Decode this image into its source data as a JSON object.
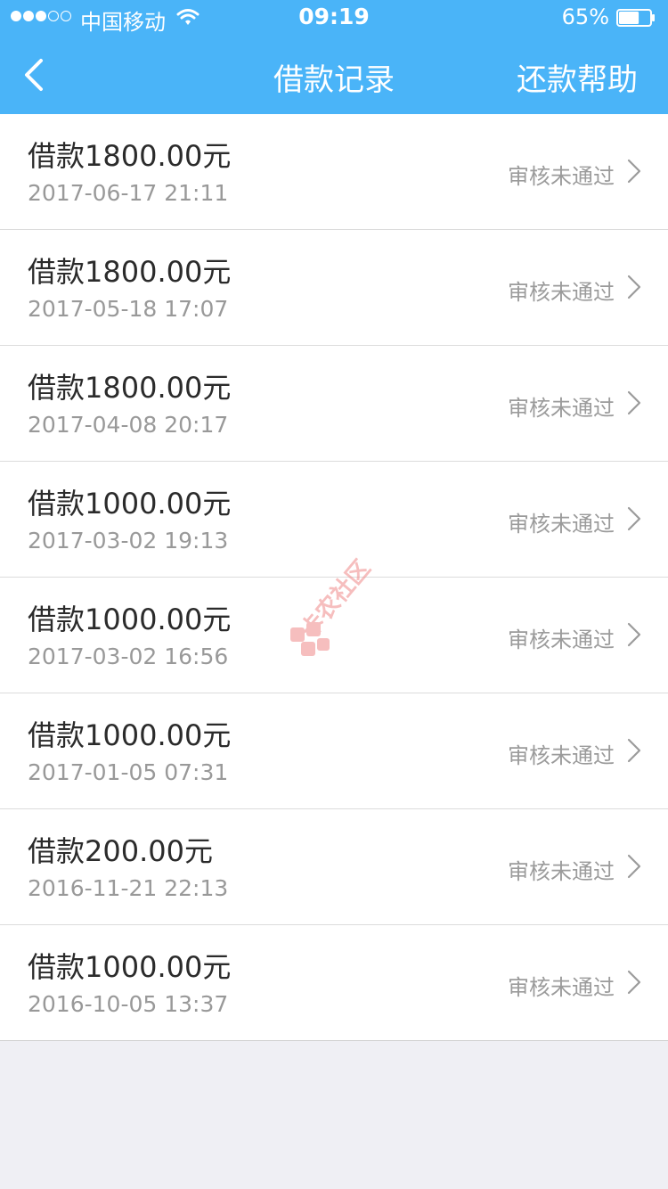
{
  "status_bar": {
    "carrier": "中国移动",
    "time": "09:19",
    "battery": "65%",
    "battery_level": 0.65
  },
  "nav": {
    "title": "借款记录",
    "right_action": "还款帮助"
  },
  "records": [
    {
      "amount": "借款1800.00元",
      "date": "2017-06-17 21:11",
      "status": "审核未通过"
    },
    {
      "amount": "借款1800.00元",
      "date": "2017-05-18 17:07",
      "status": "审核未通过"
    },
    {
      "amount": "借款1800.00元",
      "date": "2017-04-08 20:17",
      "status": "审核未通过"
    },
    {
      "amount": "借款1000.00元",
      "date": "2017-03-02 19:13",
      "status": "审核未通过"
    },
    {
      "amount": "借款1000.00元",
      "date": "2017-03-02 16:56",
      "status": "审核未通过"
    },
    {
      "amount": "借款1000.00元",
      "date": "2017-01-05 07:31",
      "status": "审核未通过"
    },
    {
      "amount": "借款200.00元",
      "date": "2016-11-21 22:13",
      "status": "审核未通过"
    },
    {
      "amount": "借款1000.00元",
      "date": "2016-10-05 13:37",
      "status": "审核未通过"
    }
  ],
  "watermark": {
    "text": "卡农社区"
  },
  "colors": {
    "header_bg": "#4ab4f8",
    "page_bg": "#efeff4",
    "status_text": "#9b9b9b",
    "watermark": "#f08a8a"
  },
  "icons": {
    "back": "back-chevron-icon",
    "row_arrow": "chevron-right-icon",
    "wifi": "wifi-icon",
    "battery": "battery-icon",
    "signal": "signal-dots-icon",
    "watermark_logo": "kanong-logo-icon"
  }
}
